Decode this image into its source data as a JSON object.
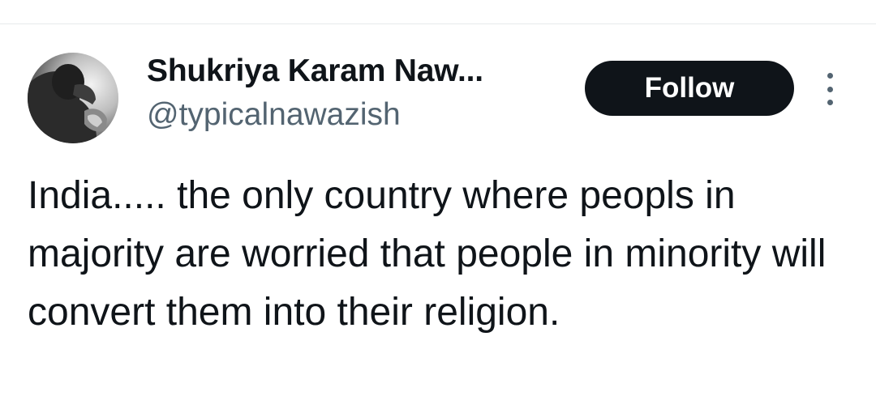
{
  "tweet": {
    "author": {
      "display_name": "Shukriya Karam Naw...",
      "handle": "@typicalnawazish",
      "avatar_icon": "profile-photo"
    },
    "follow_label": "Follow",
    "more_icon": "more-vertical-icon",
    "text": "India..... the only country where peopls in majority are worried that people in minority will convert them into their religion."
  },
  "colors": {
    "text_primary": "#0f1419",
    "text_secondary": "#536471",
    "button_bg": "#0f1419",
    "button_text": "#ffffff",
    "divider": "#e6e9eb"
  }
}
